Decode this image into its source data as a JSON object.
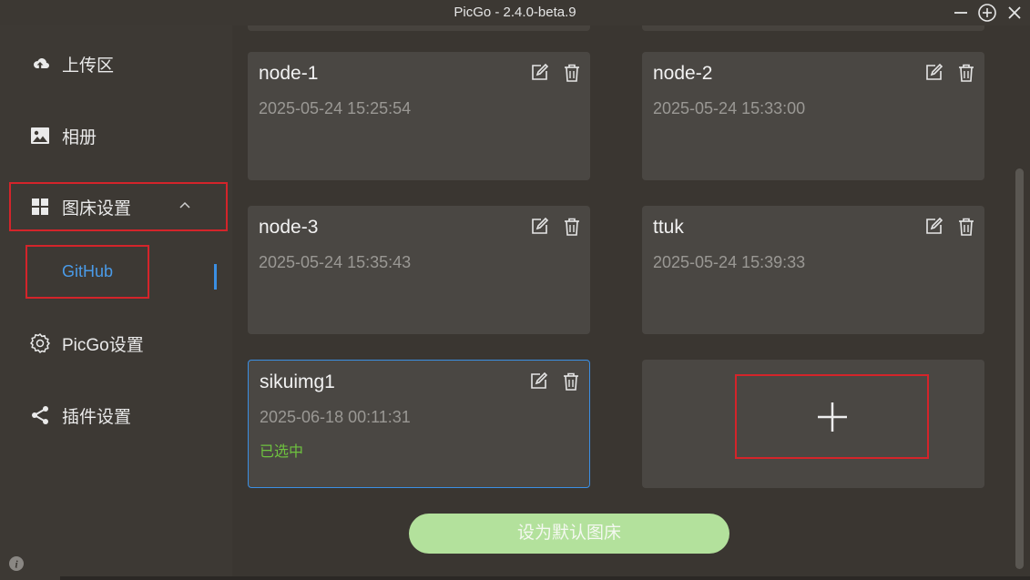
{
  "window": {
    "title": "PicGo - 2.4.0-beta.9"
  },
  "sidebar": {
    "items": [
      {
        "label": "上传区",
        "icon": "cloud-upload-icon"
      },
      {
        "label": "相册",
        "icon": "image-icon"
      },
      {
        "label": "图床设置",
        "icon": "grid-icon",
        "expanded": true
      },
      {
        "label": "PicGo设置",
        "icon": "gear-icon"
      },
      {
        "label": "插件设置",
        "icon": "share-icon"
      }
    ],
    "sub_items": [
      {
        "label": "GitHub",
        "active": true
      }
    ]
  },
  "configs": [
    {
      "name": "node-1",
      "date": "2025-05-24 15:25:54",
      "selected": false
    },
    {
      "name": "node-2",
      "date": "2025-05-24 15:33:00",
      "selected": false
    },
    {
      "name": "node-3",
      "date": "2025-05-24 15:35:43",
      "selected": false
    },
    {
      "name": "ttuk",
      "date": "2025-05-24 15:39:33",
      "selected": false
    },
    {
      "name": "sikuimg1",
      "date": "2025-06-18 00:11:31",
      "selected": true,
      "status": "已选中"
    }
  ],
  "actions": {
    "set_default_label": "设为默认图床"
  },
  "colors": {
    "accent": "#3b8fe3",
    "selected_text": "#6ec23f",
    "button_bg": "#b3e19c",
    "highlight": "#d4242a"
  }
}
